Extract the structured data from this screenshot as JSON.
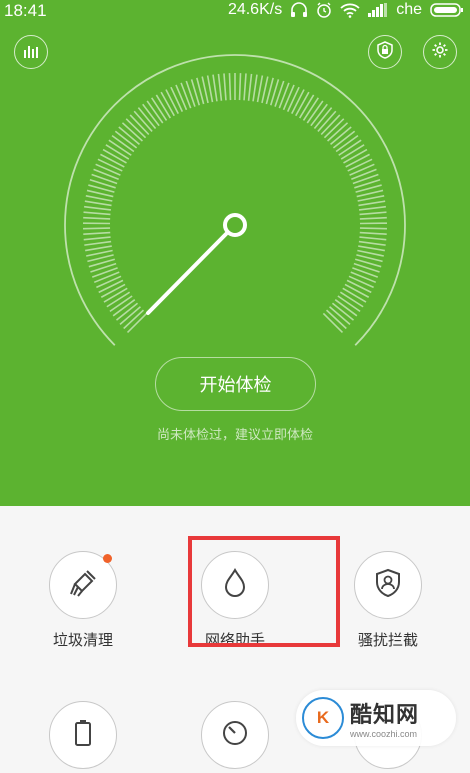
{
  "status_bar": {
    "time": "18:41",
    "speed": "24.6K/s",
    "carrier": "che"
  },
  "hero": {
    "start_button_label": "开始体检",
    "hint": "尚未体检过，建议立即体检"
  },
  "tools": [
    {
      "label": "垃圾清理",
      "icon": "broom-icon"
    },
    {
      "label": "网络助手",
      "icon": "droplet-icon"
    },
    {
      "label": "骚扰拦截",
      "icon": "shield-user-icon"
    },
    {
      "label": "",
      "icon": "battery-icon"
    },
    {
      "label": "",
      "icon": "speed-dial-icon"
    }
  ],
  "watermark": {
    "title": "酷知网",
    "url": "www.coozhi.com"
  },
  "colors": {
    "hero_green": "#5cb330",
    "highlight_red": "#e8393a",
    "badge_orange": "#f0622a"
  }
}
